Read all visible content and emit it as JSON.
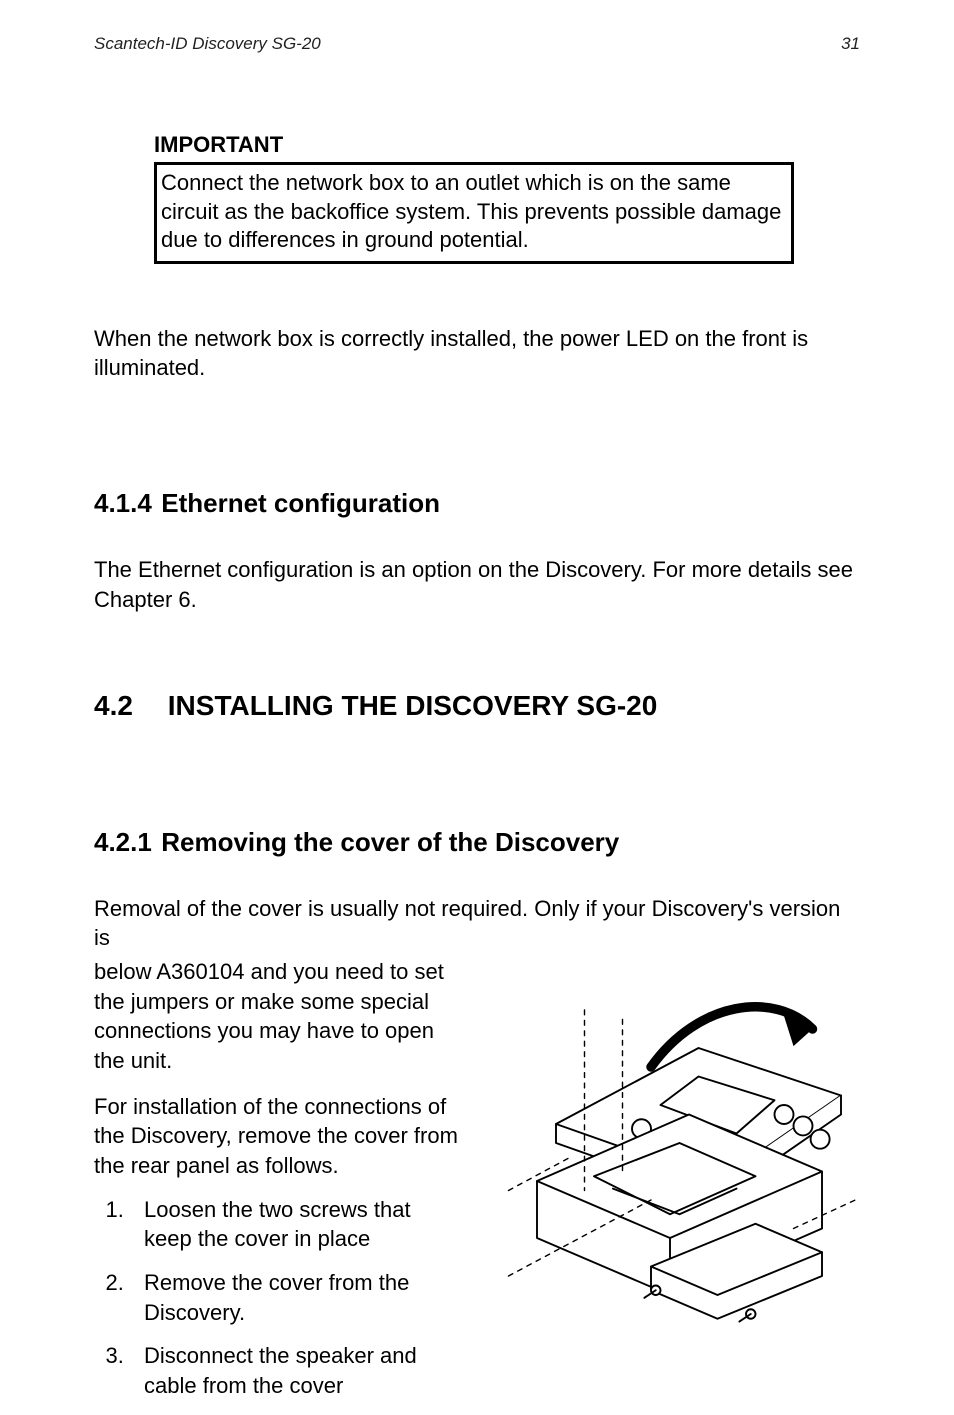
{
  "header": {
    "left": "Scantech-ID Discovery SG-20",
    "right": "31"
  },
  "important": {
    "title": "IMPORTANT",
    "body": "Connect the network box to an outlet which is on the same circuit as the backoffice system. This prevents possible damage due to differences in ground potential."
  },
  "para_after_important": "When the network box is correctly installed, the power LED on the front is illuminated.",
  "section_414": {
    "num": "4.1.4",
    "title": "Ethernet configuration",
    "body": "The Ethernet configuration is an option on the Discovery. For more details see Chapter 6."
  },
  "section_42": {
    "num": "4.2",
    "title": "INSTALLING THE DISCOVERY SG-20"
  },
  "section_421": {
    "num": "4.2.1",
    "title": "Removing the cover of the Discovery",
    "intro_line1": "Removal of the cover is usually not required. Only if your Discovery's version is",
    "intro_rest": "below A360104 and you need to set the jumpers or make some special connections you may have to open the unit.",
    "para2": "For installation of the connections of the Discovery, remove the cover from the rear panel as follows.",
    "steps": [
      "Loosen the two screws that keep the cover in place",
      "Remove the cover from the Discovery.",
      "Disconnect the speaker and cable from the cover"
    ]
  },
  "illustration": {
    "name": "discovery-remove-cover-illustration"
  }
}
